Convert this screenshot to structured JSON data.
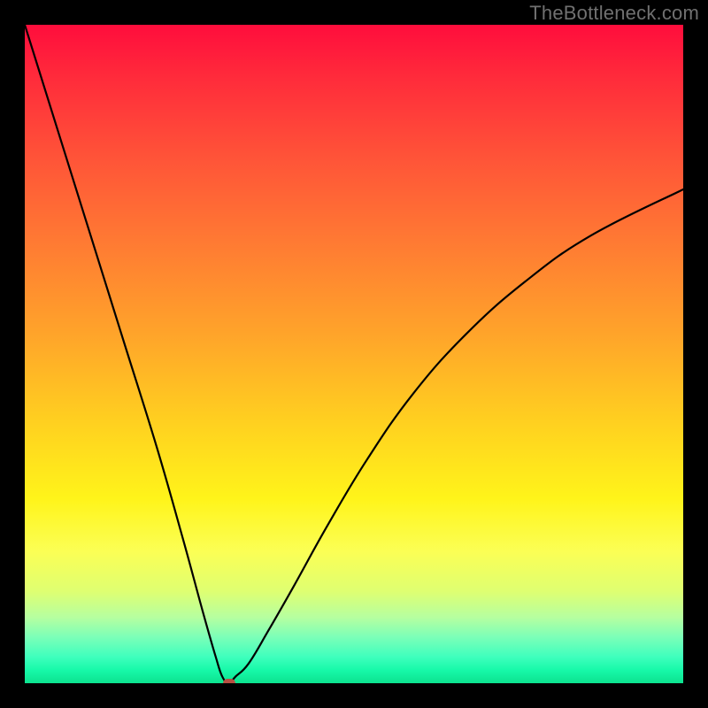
{
  "watermark": "TheBottleneck.com",
  "chart_data": {
    "type": "line",
    "title": "",
    "xlabel": "",
    "ylabel": "",
    "xlim": [
      0,
      100
    ],
    "ylim": [
      0,
      100
    ],
    "legend": false,
    "grid": false,
    "background": "rainbow_vertical_gradient",
    "background_stops": [
      {
        "pos": 0,
        "color": "#ff0d3c"
      },
      {
        "pos": 33,
        "color": "#ff7a33"
      },
      {
        "pos": 60,
        "color": "#ffcf20"
      },
      {
        "pos": 80,
        "color": "#fbff55"
      },
      {
        "pos": 100,
        "color": "#0ce28f"
      }
    ],
    "series": [
      {
        "name": "bottleneck_curve",
        "color": "#000000",
        "x": [
          0,
          5,
          10,
          15,
          20,
          24,
          27,
          29,
          30,
          31,
          32,
          34,
          37,
          41,
          46,
          52,
          59,
          67,
          76,
          86,
          100
        ],
        "y": [
          100,
          84,
          68,
          52,
          36,
          22,
          11,
          4,
          1,
          0,
          1,
          3,
          8,
          15,
          24,
          34,
          44,
          53,
          61,
          68,
          75
        ]
      }
    ],
    "marker": {
      "x": 31,
      "y": 0,
      "color": "#b84f42"
    }
  }
}
